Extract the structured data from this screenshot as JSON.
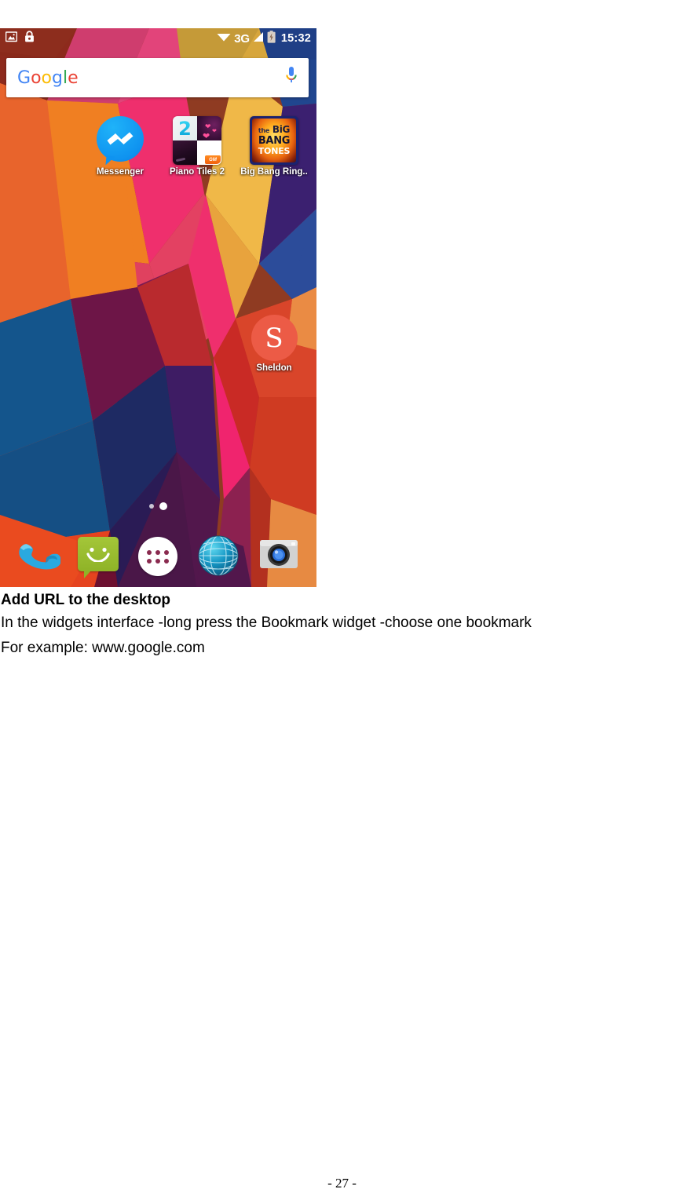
{
  "document": {
    "heading": "Add URL to the desktop",
    "paragraphs": [
      "In the widgets interface -long press the Bookmark widget -choose one bookmark",
      "For example: www.google.com"
    ],
    "page_number": "- 27 -"
  },
  "phone": {
    "status_bar": {
      "time": "15:32",
      "network_type": "3G",
      "left_icons": [
        "screenshot-icon",
        "lock-icon"
      ],
      "right_icons": [
        "wifi-icon",
        "signal-icon",
        "battery-icon"
      ]
    },
    "search_widget": {
      "logo_letters": [
        {
          "char": "G",
          "color": "#4285F4"
        },
        {
          "char": "o",
          "color": "#EA4335"
        },
        {
          "char": "o",
          "color": "#FBBC05"
        },
        {
          "char": "g",
          "color": "#4285F4"
        },
        {
          "char": "l",
          "color": "#34A853"
        },
        {
          "char": "e",
          "color": "#EA4335"
        }
      ],
      "logo_text": "Google",
      "mic_icon": "microphone-icon"
    },
    "apps": [
      {
        "label": "Messenger",
        "icon": "messenger-icon"
      },
      {
        "label": "Piano Tiles 2",
        "icon": "piano-tiles-2-icon",
        "tile_number": "2",
        "tile_badge": "GM"
      },
      {
        "label": "Big Bang Ring..",
        "icon": "big-bang-tones-icon",
        "art_lines": [
          "the BiG",
          "BANG",
          "TONES"
        ]
      }
    ],
    "contact_shortcut": {
      "label": "Sheldon",
      "initial": "S",
      "color": "#ec5b46"
    },
    "page_indicator": {
      "count": 2,
      "active_index": 1
    },
    "dock": [
      {
        "label": "Phone",
        "icon": "phone-icon"
      },
      {
        "label": "Messaging",
        "icon": "messaging-icon"
      },
      {
        "label": "Apps",
        "icon": "app-drawer-icon"
      },
      {
        "label": "Browser",
        "icon": "browser-globe-icon"
      },
      {
        "label": "Camera",
        "icon": "camera-icon"
      }
    ],
    "wallpaper": {
      "name": "geometric-polygon-wallpaper",
      "colors": [
        "#8f3b22",
        "#e8622a",
        "#f07b22",
        "#ee2f6c",
        "#e0425f",
        "#c92a2a",
        "#7a1030",
        "#6d1547",
        "#8b1b5c",
        "#3b1a63",
        "#1f3b78",
        "#15548a",
        "#e8a33d",
        "#f0b848",
        "#b32020",
        "#d9452a"
      ]
    }
  }
}
